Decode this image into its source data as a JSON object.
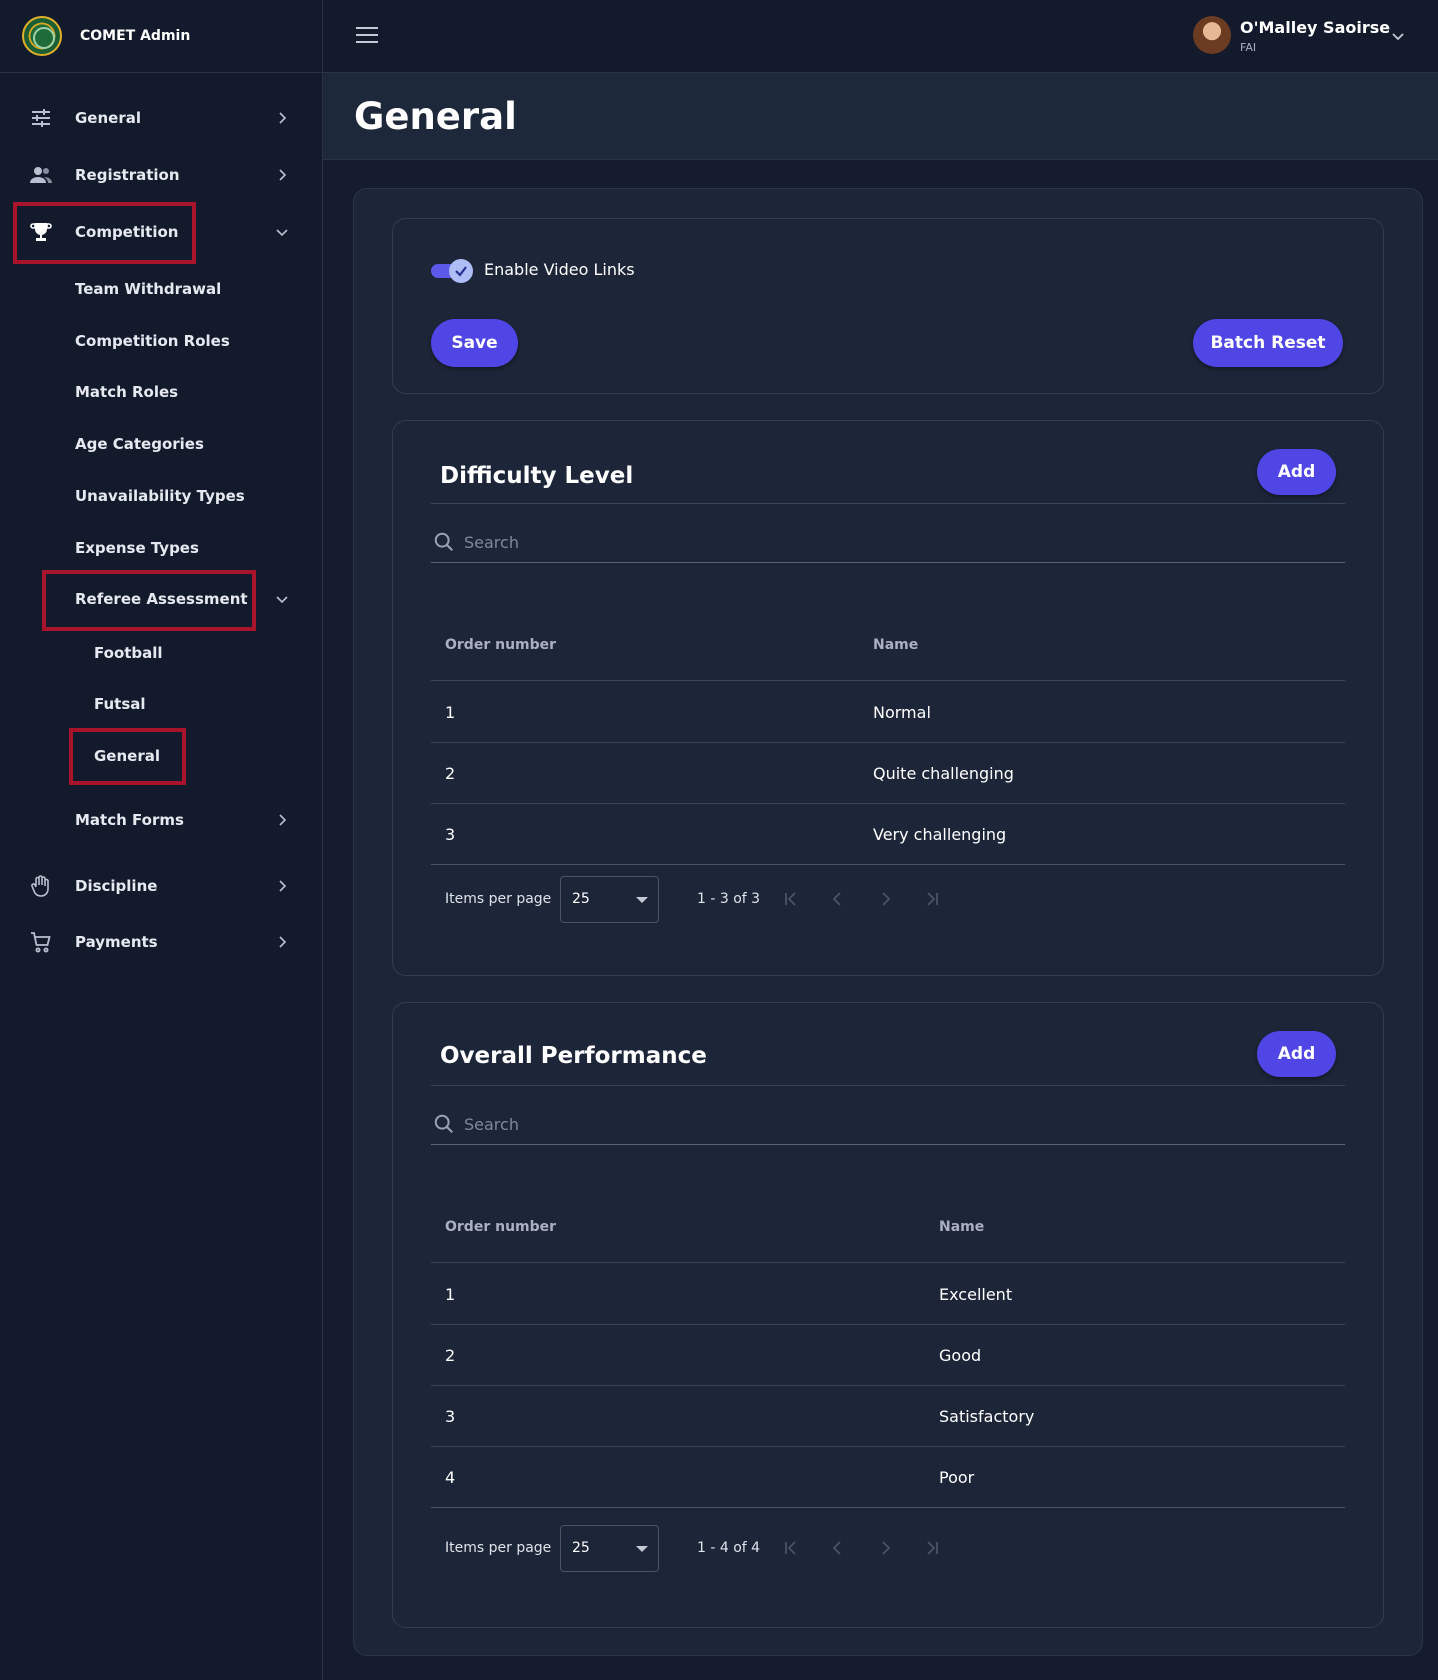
{
  "brand": {
    "name": "COMET Admin",
    "logo_icon": "comet-logo-icon"
  },
  "sidebar": {
    "items": [
      {
        "label": "General",
        "icon": "sliders-icon"
      },
      {
        "label": "Registration",
        "icon": "users-icon"
      },
      {
        "label": "Competition",
        "icon": "trophy-icon",
        "expanded": true
      },
      {
        "label": "Discipline",
        "icon": "hand-icon"
      },
      {
        "label": "Payments",
        "icon": "cart-icon"
      }
    ],
    "competition_children": [
      "Team Withdrawal",
      "Competition Roles",
      "Match Roles",
      "Age Categories",
      "Unavailability Types",
      "Expense Types",
      "Referee Assessment",
      "Match Forms"
    ],
    "referee_assessment_children": [
      "Football",
      "Futsal",
      "General"
    ],
    "highlight_color": "#a8142b"
  },
  "topbar": {
    "user_name": "O'Malley Saoirse",
    "user_org": "FAI"
  },
  "page": {
    "title": "General"
  },
  "settings_card": {
    "toggle_label": "Enable Video Links",
    "toggle_on": true,
    "save_label": "Save",
    "batch_reset_label": "Batch Reset"
  },
  "difficulty": {
    "title": "Difficulty Level",
    "add_label": "Add",
    "search_placeholder": "Search",
    "columns": [
      "Order number",
      "Name"
    ],
    "rows": [
      {
        "order": "1",
        "name": "Normal"
      },
      {
        "order": "2",
        "name": "Quite challenging"
      },
      {
        "order": "3",
        "name": "Very challenging"
      }
    ],
    "items_per_page_label": "Items per page",
    "items_per_page": "25",
    "range": "1 - 3 of 3"
  },
  "performance": {
    "title": "Overall Performance",
    "add_label": "Add",
    "search_placeholder": "Search",
    "columns": [
      "Order number",
      "Name"
    ],
    "rows": [
      {
        "order": "1",
        "name": "Excellent"
      },
      {
        "order": "2",
        "name": "Good"
      },
      {
        "order": "3",
        "name": "Satisfactory"
      },
      {
        "order": "4",
        "name": "Poor"
      }
    ],
    "items_per_page_label": "Items per page",
    "items_per_page": "25",
    "range": "1 - 4 of 4"
  },
  "colors": {
    "accent": "#4f46e5",
    "background": "#141c2e",
    "panel": "#1d2638"
  }
}
